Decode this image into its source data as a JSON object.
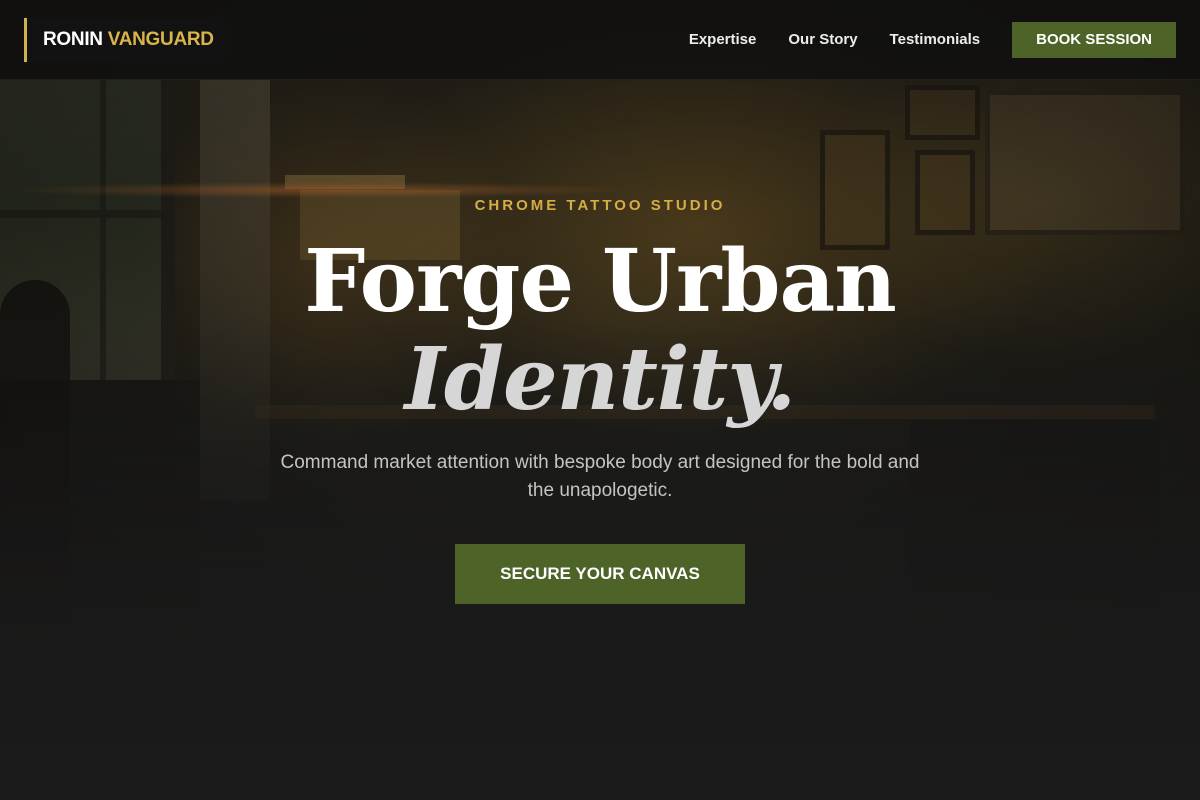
{
  "brand": {
    "primary": "RONIN",
    "accent": "VANGUARD",
    "accent_color": "#d9b44a"
  },
  "nav": {
    "links": [
      "Expertise",
      "Our Story",
      "Testimonials"
    ],
    "cta_label": "BOOK SESSION"
  },
  "hero": {
    "eyebrow": "CHROME TATTOO STUDIO",
    "headline_line1": "Forge Urban",
    "headline_line2": "Identity.",
    "subtitle": "Command market attention with bespoke body art designed for the bold and the unapologetic.",
    "cta_label": "SECURE YOUR CANVAS",
    "background_image": "dim tattoo studio interior photo"
  },
  "colors": {
    "accent_green": "#4d6327",
    "accent_gold": "#d4ad45",
    "background": "#1b1b1b"
  }
}
